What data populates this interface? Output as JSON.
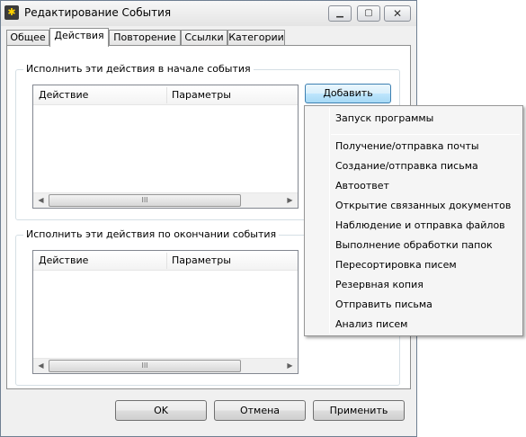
{
  "window": {
    "title": "Редактирование События",
    "app_icon_glyph": "✱",
    "buttons": {
      "minimize": "▁",
      "maximize": "▢",
      "close": "✕"
    }
  },
  "tabs": [
    {
      "label": "Общее",
      "active": false
    },
    {
      "label": "Действия",
      "active": true
    },
    {
      "label": "Повторение",
      "active": false
    },
    {
      "label": "Ссылки",
      "active": false
    },
    {
      "label": "Категории",
      "active": false
    }
  ],
  "start_group": {
    "legend": "Исполнить эти действия в начале события",
    "columns": [
      "Действие",
      "Параметры"
    ],
    "rows": []
  },
  "end_group": {
    "legend": "Исполнить эти действия по окончании события",
    "columns": [
      "Действие",
      "Параметры"
    ],
    "rows": []
  },
  "scroll": {
    "left": "◀",
    "right": "▶",
    "grip": "III"
  },
  "add_button": {
    "label": "Добавить"
  },
  "add_menu": {
    "first": "Запуск программы",
    "items": [
      "Получение/отправка почты",
      "Создание/отправка письма",
      "Автоответ",
      "Открытие связанных документов",
      "Наблюдение и отправка файлов",
      "Выполнение обработки папок",
      "Пересортировка писем",
      "Резервная копия",
      "Отправить письма",
      "Анализ писем"
    ]
  },
  "footer": {
    "ok": "OK",
    "cancel": "Отмена",
    "apply": "Применить"
  },
  "colors": {
    "accent_border": "#3c7fb1",
    "window_bg": "#f0f0f0",
    "panel_bg": "#ffffff"
  }
}
